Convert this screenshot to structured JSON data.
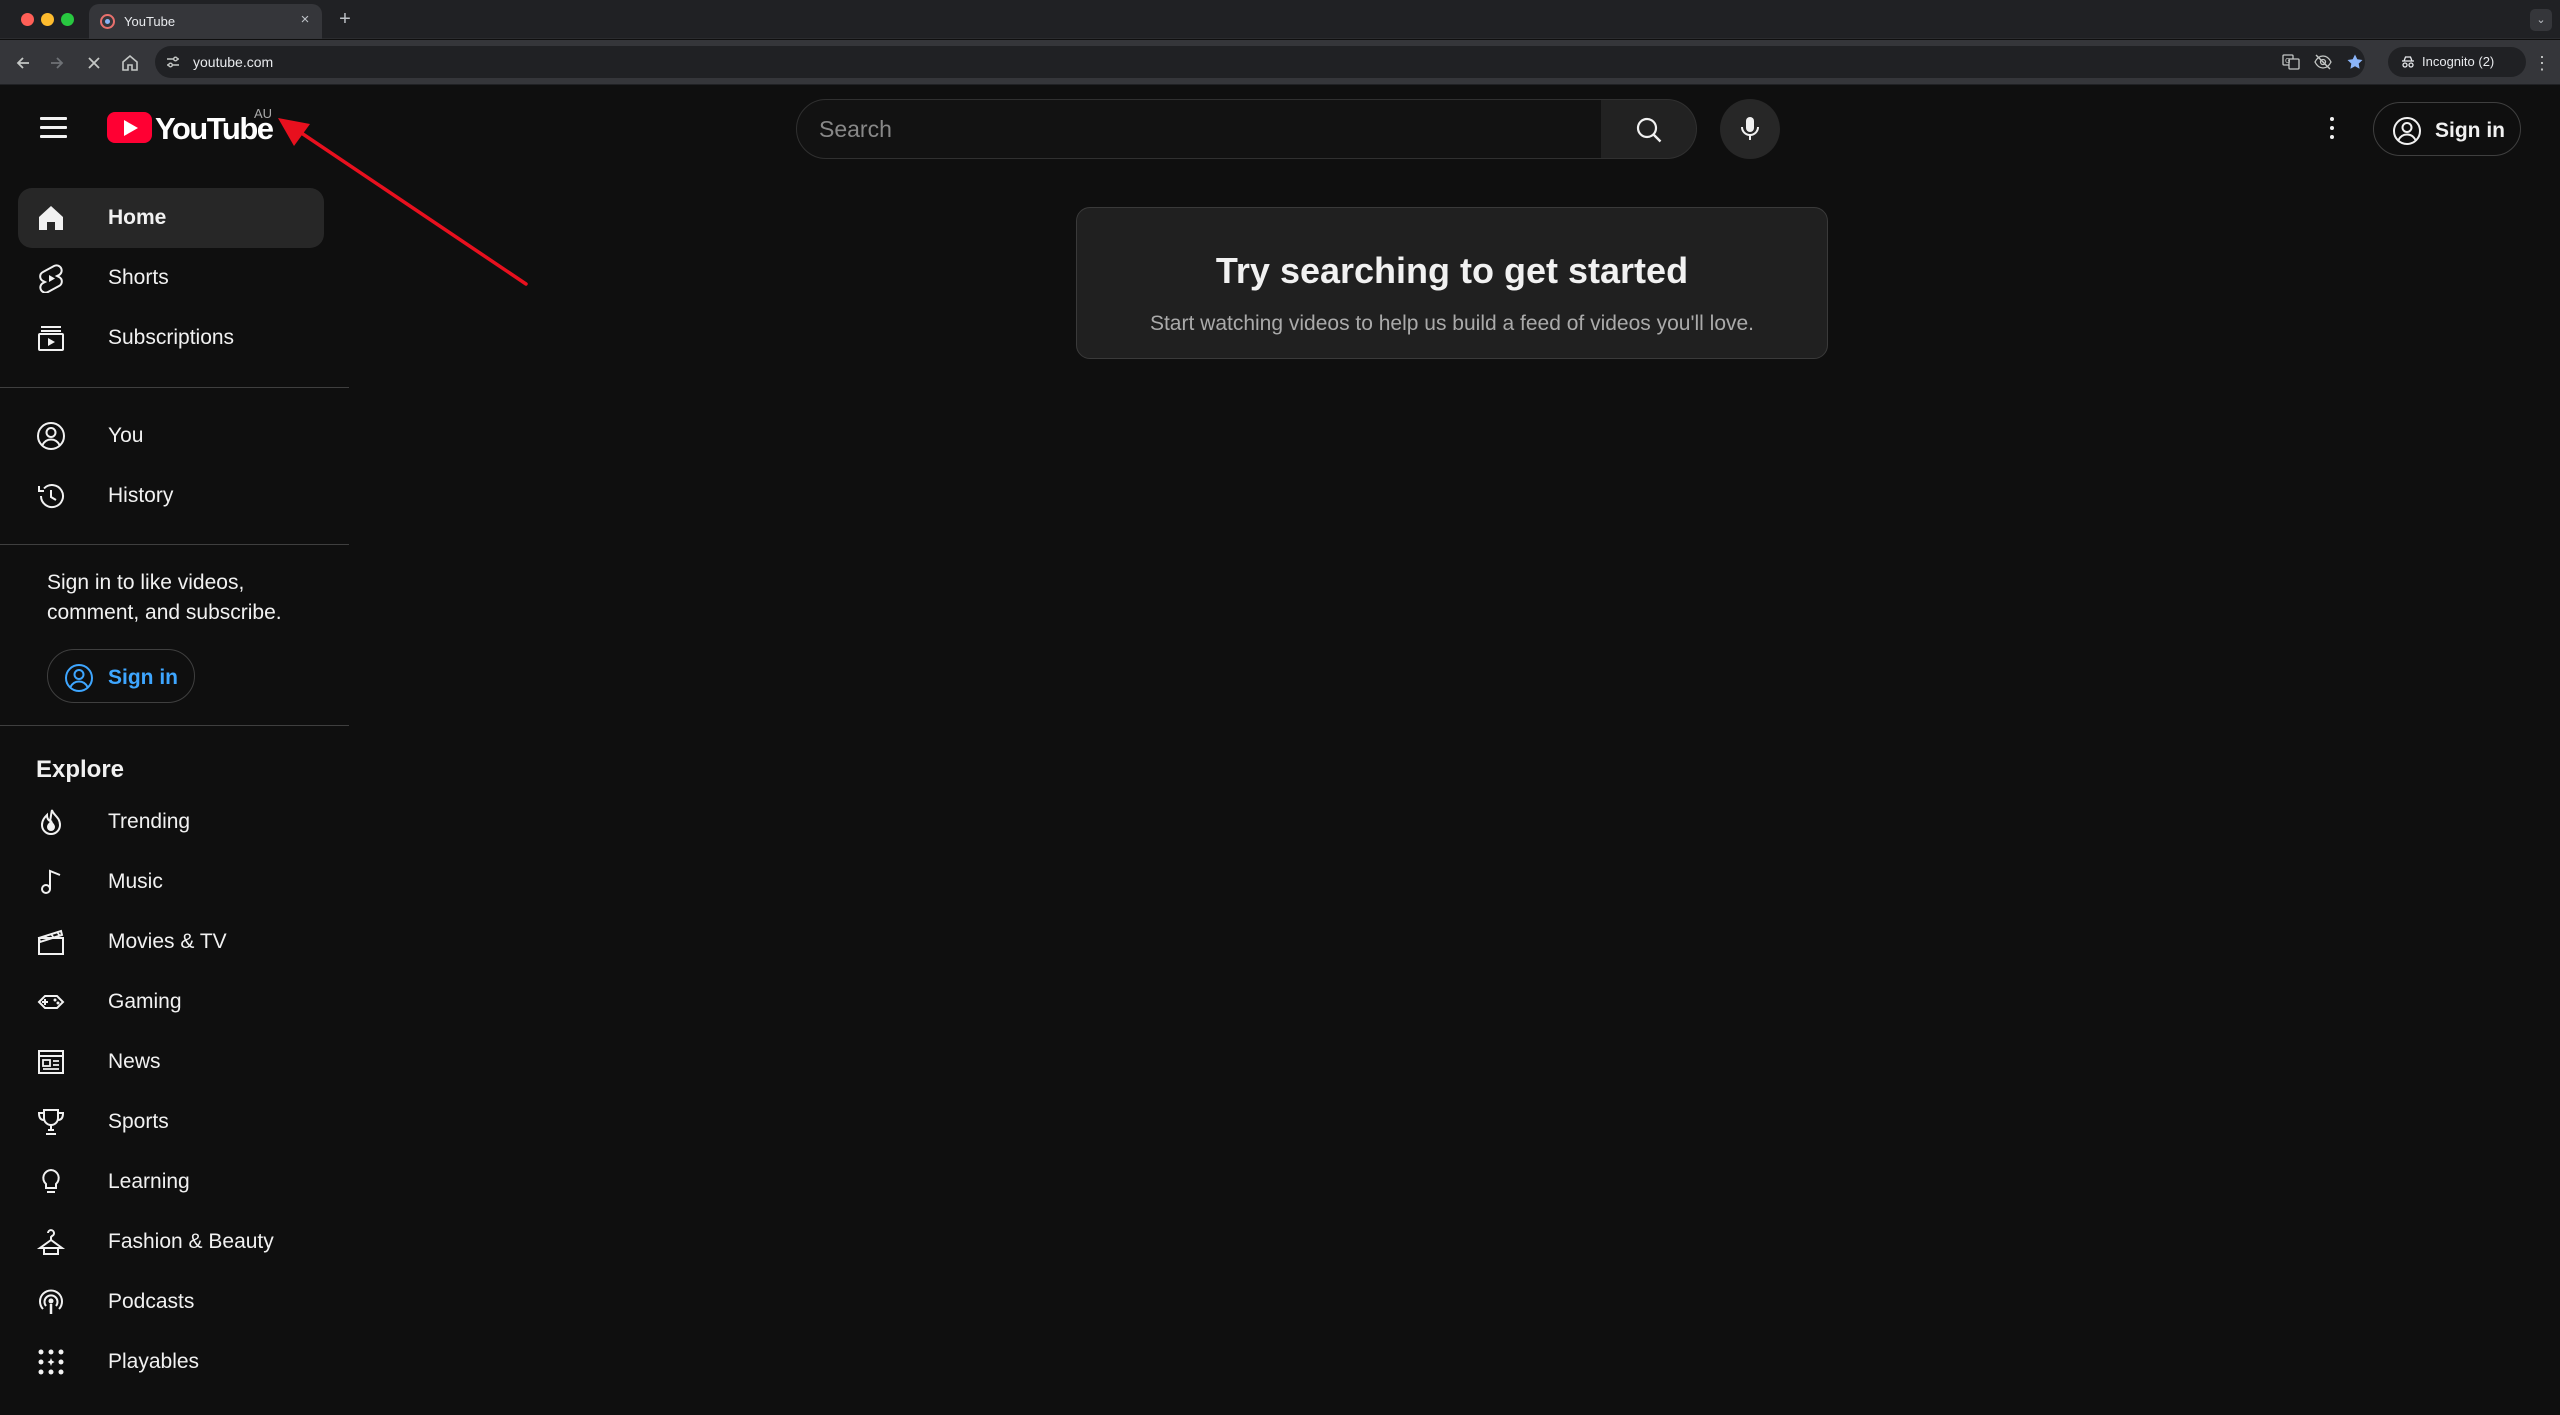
{
  "browser": {
    "tab_title": "YouTube",
    "tab_close": "×",
    "new_tab": "+",
    "tab_search": "⌄",
    "url": "youtube.com",
    "incognito_label": "Incognito (2)",
    "menu": "⋮",
    "icons": [
      "back-icon",
      "forward-icon",
      "stop-icon",
      "home-icon",
      "site-info-icon",
      "translate-icon",
      "eye-off-icon",
      "star-icon",
      "incognito-icon"
    ]
  },
  "masthead": {
    "logo_text": "YouTube",
    "country_code": "AU",
    "search_placeholder": "Search",
    "sign_in": "Sign in"
  },
  "sidebar": {
    "primary": [
      {
        "label": "Home",
        "icon": "home-icon",
        "active": true
      },
      {
        "label": "Shorts",
        "icon": "shorts-icon"
      },
      {
        "label": "Subscriptions",
        "icon": "subscriptions-icon"
      }
    ],
    "secondary": [
      {
        "label": "You",
        "icon": "account-icon"
      },
      {
        "label": "History",
        "icon": "history-icon"
      }
    ],
    "signin_prompt": "Sign in to like videos, comment, and subscribe.",
    "sign_in": "Sign in",
    "explore_title": "Explore",
    "explore": [
      {
        "label": "Trending",
        "icon": "trending-icon"
      },
      {
        "label": "Music",
        "icon": "music-icon"
      },
      {
        "label": "Movies & TV",
        "icon": "movies-icon"
      },
      {
        "label": "Gaming",
        "icon": "gaming-icon"
      },
      {
        "label": "News",
        "icon": "news-icon"
      },
      {
        "label": "Sports",
        "icon": "sports-icon"
      },
      {
        "label": "Learning",
        "icon": "learning-icon"
      },
      {
        "label": "Fashion & Beauty",
        "icon": "fashion-icon"
      },
      {
        "label": "Podcasts",
        "icon": "podcasts-icon"
      },
      {
        "label": "Playables",
        "icon": "playables-icon"
      }
    ]
  },
  "main": {
    "empty_title": "Try searching to get started",
    "empty_subtitle": "Start watching videos to help us build a feed of videos you'll love."
  },
  "colors": {
    "background": "#0f0f0f",
    "brand_red": "#ff0033",
    "link_blue": "#3ea6ff",
    "annotation_arrow": "#e8101e"
  }
}
